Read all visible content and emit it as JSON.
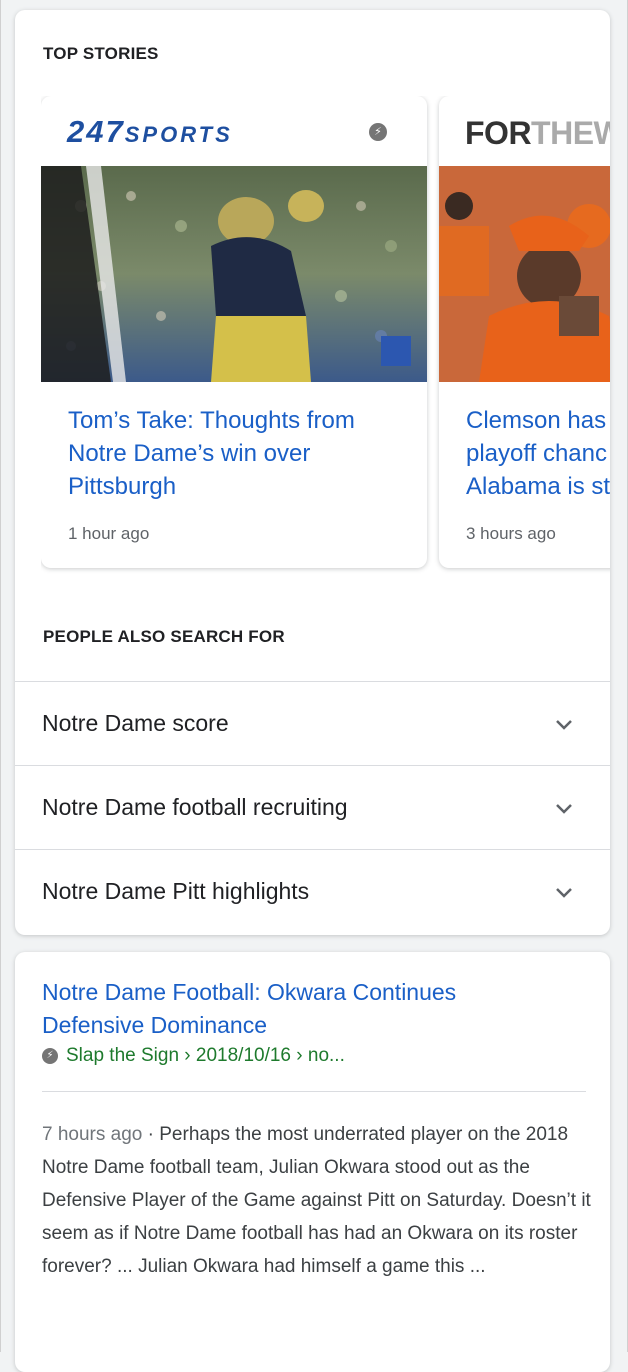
{
  "top_stories": {
    "heading": "TOP STORIES",
    "stories": [
      {
        "source_logo": "247SPORTS",
        "source_logo_main": "247",
        "source_logo_suffix": "SPORTS",
        "amp_icon": "amp-lightning-icon",
        "title_lines": [
          "Tom’s Take: Thoughts from",
          "Notre Dame’s win over",
          "Pittsburgh"
        ],
        "time": "1 hour ago",
        "image": "notre-dame-football-player-photo"
      },
      {
        "source_logo": "FORTHEWIN",
        "source_logo_main": "FOR",
        "source_logo_suffix": "THEW",
        "title_lines": [
          "Clemson has",
          "playoff chanc",
          "Alabama is st"
        ],
        "time": "3 hours ago",
        "image": "clemson-coach-photo"
      }
    ]
  },
  "people_also_search": {
    "heading": "PEOPLE ALSO SEARCH FOR",
    "items": [
      {
        "label": "Notre Dame score"
      },
      {
        "label": "Notre Dame football recruiting"
      },
      {
        "label": "Notre Dame Pitt highlights"
      }
    ],
    "expand_icon": "chevron-down-icon"
  },
  "result": {
    "title_lines": [
      "Notre Dame Football: Okwara Continues",
      "Defensive Dominance"
    ],
    "url": "Slap the Sign › 2018/10/16 › no...",
    "date": "7 hours ago",
    "separator": " · ",
    "snippet": "Perhaps the most underrated player on the 2018 Notre Dame football team, Julian Okwara stood out as the Defensive Player of the Game against Pitt on Saturday. Doesn’t it seem as if Notre Dame football has had an Okwara on its roster forever? ... Julian Okwara had himself a game this ..."
  },
  "colors": {
    "link_blue": "#1a5fc7",
    "url_green": "#1e7a2d",
    "logo_blue": "#1e4fa0",
    "logo_green": "#5fb548"
  }
}
